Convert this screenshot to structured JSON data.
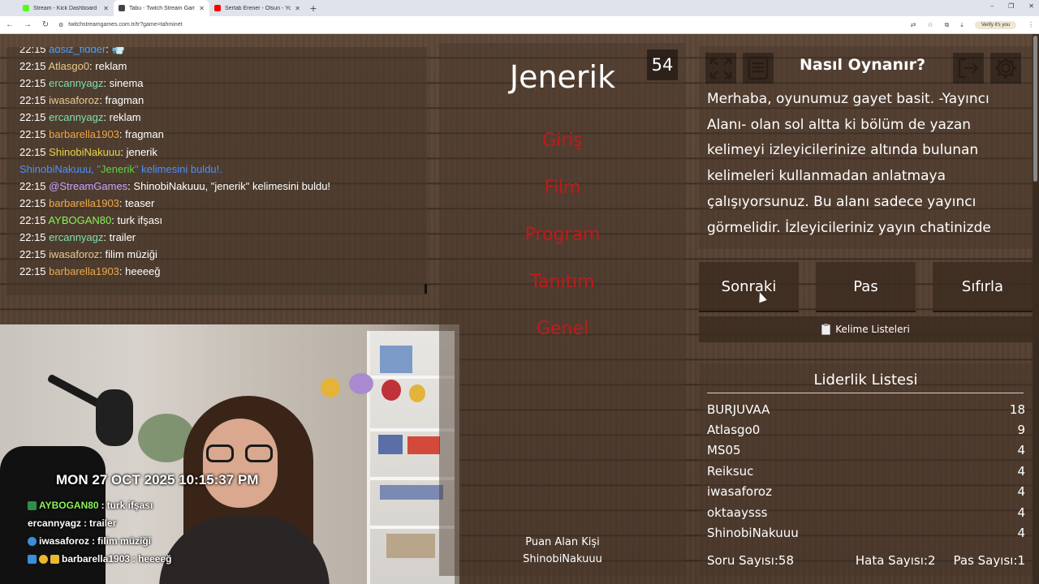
{
  "browser": {
    "tabs": [
      {
        "title": "Stream - Kick Dashboard",
        "color": "#53fc18",
        "active": false
      },
      {
        "title": "Tabu - Twitch Stream Games",
        "color": "#444444",
        "active": true
      },
      {
        "title": "Sertab Erener - Olsun - YouTube",
        "color": "#ff0000",
        "active": false
      }
    ],
    "new_tab": "+",
    "url": "twitchstreamgames.com.tr/tr?game=tahminet",
    "verify_label": "Verify it's you",
    "window_controls": [
      "–",
      "❐",
      "✕"
    ]
  },
  "chat": {
    "lines": [
      {
        "time": "22:15",
        "user": "adsiz_fidder",
        "msg": "💨",
        "color": "u-blue"
      },
      {
        "time": "22:15",
        "user": "Atlasgo0",
        "msg": "reklam",
        "color": "u-tan"
      },
      {
        "time": "22:15",
        "user": "ercannyagz",
        "msg": "sinema",
        "color": "u-mint"
      },
      {
        "time": "22:15",
        "user": "iwasaforoz",
        "msg": "fragman",
        "color": "u-tan"
      },
      {
        "time": "22:15",
        "user": "ercannyagz",
        "msg": "reklam",
        "color": "u-mint"
      },
      {
        "time": "22:15",
        "user": "barbarella1903",
        "msg": "fragman",
        "color": "u-orange"
      },
      {
        "time": "22:15",
        "user": "ShinobiNakuuu",
        "msg": "jenerik",
        "color": "u-yellow"
      }
    ],
    "system": {
      "prefix": "ShinobiNakuuu, \"",
      "word": "Jenerik",
      "suffix": "\" kelimesini buldu!."
    },
    "lines2": [
      {
        "time": "22:15",
        "user": "@StreamGames",
        "msg": "ShinobiNakuuu, \"jenerik\" kelimesini buldu!",
        "color": "u-violet"
      },
      {
        "time": "22:15",
        "user": "barbarella1903",
        "msg": "teaser",
        "color": "u-orange"
      },
      {
        "time": "22:15",
        "user": "AYBOGAN80",
        "msg": "turk ifşası",
        "color": "u-lime"
      },
      {
        "time": "22:15",
        "user": "ercannyagz",
        "msg": "trailer",
        "color": "u-mint"
      },
      {
        "time": "22:15",
        "user": "iwasaforoz",
        "msg": "filim müziği",
        "color": "u-tan"
      },
      {
        "time": "22:15",
        "user": "barbarella1903",
        "msg": "heeeeğ",
        "color": "u-orange"
      }
    ]
  },
  "webcam": {
    "date": "MON 27 OCT 2025 10:15:37 PM",
    "chat": [
      {
        "user": "AYBOGAN80",
        "msg": "turk ifşası"
      },
      {
        "user": "ercannyagz",
        "msg": "trailer"
      },
      {
        "user": "iwasaforoz",
        "msg": "filim müziği"
      },
      {
        "user": "barbarella1903",
        "msg": "heeeeğ"
      }
    ]
  },
  "game": {
    "counter": "54",
    "main_word": "Jenerik",
    "taboo_words": [
      "Giriş",
      "Film",
      "Program",
      "Tanıtım",
      "Genel"
    ],
    "scorer_label": "Puan Alan Kişi",
    "scorer_name": "ShinobiNakuuu"
  },
  "how_to": {
    "title": "Nasıl Oynanır?",
    "text": "Merhaba, oyunumuz gayet basit. -Yayıncı Alanı- olan sol altta ki bölüm de yazan kelimeyi izleyicilerinize altında bulunan kelimeleri kullanmadan anlatmaya çalışıyorsunuz. Bu alanı sadece yayıncı görmelidir. İzleyicileriniz yayın chatinizde tahmin edilir."
  },
  "controls": {
    "next": "Sonraki",
    "pass": "Pas",
    "reset": "Sıfırla",
    "word_lists": "Kelime Listeleri"
  },
  "leaderboard": {
    "title": "Liderlik Listesi",
    "rows": [
      {
        "name": "BURJUVAA",
        "score": "18"
      },
      {
        "name": "Atlasgo0",
        "score": "9"
      },
      {
        "name": "MS05",
        "score": "4"
      },
      {
        "name": "Reiksuc",
        "score": "4"
      },
      {
        "name": "iwasaforoz",
        "score": "4"
      },
      {
        "name": "oktaaysss",
        "score": "4"
      },
      {
        "name": "ShinobiNakuuu",
        "score": "4"
      }
    ],
    "questions": "Soru Sayısı:58",
    "errors": "Hata Sayısı:2",
    "passes": "Pas Sayısı:1"
  }
}
